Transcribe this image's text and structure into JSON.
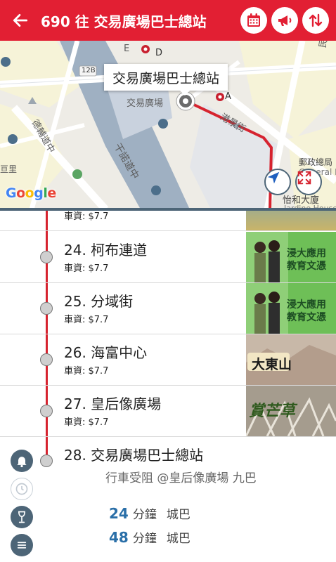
{
  "header": {
    "title": "690 往 交易廣場巴士總站",
    "back_icon": "arrow-left-icon",
    "buttons": [
      {
        "icon": "calendar-icon"
      },
      {
        "icon": "megaphone-icon"
      },
      {
        "icon": "swap-vertical-icon"
      }
    ],
    "color": "#e21f33"
  },
  "map": {
    "callout": "交易廣場巴士總站",
    "labels": {
      "station_e": "E",
      "station_d": "D",
      "station_a": "A",
      "exchange_square": "交易廣場",
      "connaught_road": "干諾道中",
      "des_voeux_road": "德輔道中",
      "man_yiu_street": "民耀街",
      "kong_sin_street": "港景街",
      "post_office_1": "郵政總局",
      "post_office_2": "General Post C",
      "ihc_1": "怡和大廈",
      "ihc_2": "Jardine House",
      "route_12b": "12B",
      "partial_left": "亘里"
    },
    "logo": "Google",
    "route_color": "#d6232f"
  },
  "stops": [
    {
      "name": "",
      "fare": "車資: $7.7"
    },
    {
      "name": "24. 柯布連道",
      "fare": "車資: $7.7"
    },
    {
      "name": "25. 分域街",
      "fare": "車資: $7.7"
    },
    {
      "name": "26. 海富中心",
      "fare": "車資: $7.7"
    },
    {
      "name": "27. 皇后像廣場",
      "fare": "車資: $7.7"
    }
  ],
  "ads": [
    {
      "text": ""
    },
    {
      "text": "浸大應用\n教育文憑"
    },
    {
      "text": "浸大應用\n教育文憑"
    },
    {
      "text": "大東山"
    },
    {
      "text": "賞芒草"
    }
  ],
  "last_stop": {
    "name": "28. 交易廣場巴士總站",
    "notice": "行車受阻 @皇后像廣場 九巴",
    "etas": [
      {
        "minutes": "24",
        "unit": "分鐘",
        "company": "城巴"
      },
      {
        "minutes": "48",
        "unit": "分鐘",
        "company": "城巴"
      }
    ]
  },
  "side_icons": [
    "bell-icon",
    "clock-icon",
    "wine-glass-icon",
    "menu-icon"
  ]
}
